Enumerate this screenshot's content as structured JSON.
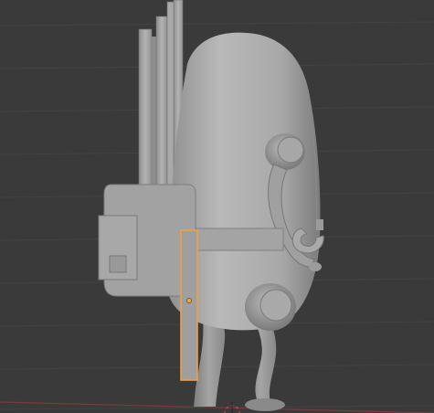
{
  "viewport": {
    "background_color": "#3a3a3a",
    "grid_color": "#454545",
    "model_color_light": "#b5b5b5",
    "model_color_mid": "#9c9c9c",
    "model_color_dark": "#6f6f6f",
    "selection_color": "#f0a040",
    "origin_color": "#f2a63a",
    "x_axis_color": "#8a3a3a"
  },
  "scene": {
    "objects": [
      {
        "name": "body",
        "icon": "mesh-object"
      },
      {
        "name": "backpack",
        "icon": "mesh-object"
      },
      {
        "name": "antennas",
        "icon": "mesh-object"
      },
      {
        "name": "arm",
        "icon": "mesh-object"
      },
      {
        "name": "legs",
        "icon": "mesh-object"
      },
      {
        "name": "selected-rod",
        "icon": "mesh-object",
        "selected": true
      }
    ],
    "cursor_icon": "3d-cursor-icon",
    "origin_icon": "object-origin-icon"
  }
}
